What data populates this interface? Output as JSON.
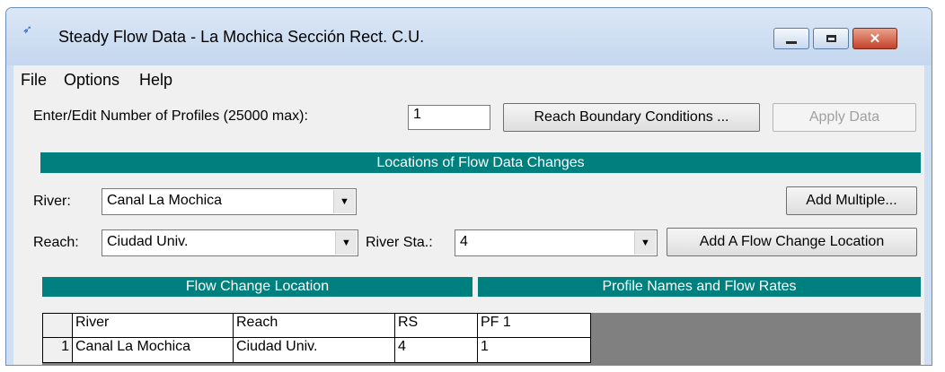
{
  "window": {
    "title": "Steady Flow Data - La Mochica Sección Rect. C.U.",
    "close_glyph": "✕"
  },
  "menu": {
    "items": [
      "File",
      "Options",
      "Help"
    ]
  },
  "profiles": {
    "label": "Enter/Edit Number of Profiles (25000 max):",
    "value": "1"
  },
  "buttons": {
    "reach_boundary": "Reach Boundary Conditions ...",
    "apply_data": "Apply Data",
    "add_multiple": "Add Multiple...",
    "add_flow_change": "Add A Flow Change Location"
  },
  "locations_header": "Locations of Flow Data Changes",
  "river": {
    "label": "River:",
    "value": "Canal La Mochica"
  },
  "reach": {
    "label": "Reach:",
    "value": "Ciudad Univ."
  },
  "river_sta": {
    "label": "River Sta.:",
    "value": "4"
  },
  "table": {
    "group_left": "Flow Change Location",
    "group_right": "Profile Names and Flow Rates",
    "columns": [
      "River",
      "Reach",
      "RS",
      "PF 1"
    ],
    "rows": [
      {
        "num": "1",
        "river": "Canal La Mochica",
        "reach": "Ciudad Univ.",
        "rs": "4",
        "pf1": "1"
      }
    ]
  },
  "icons": {
    "app": "hecras-app-icon",
    "dropdown": "dropdown-arrow-icon"
  },
  "colors": {
    "section_header": "#007f7f",
    "grid_background": "#808080",
    "close_button": "#c5412a"
  }
}
